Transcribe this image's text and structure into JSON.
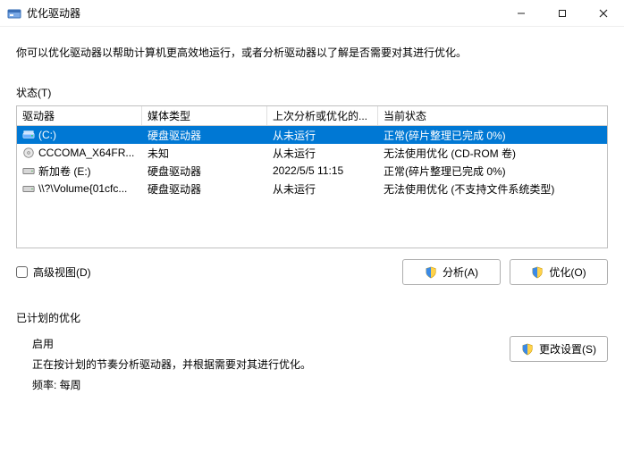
{
  "window": {
    "title": "优化驱动器"
  },
  "description": "你可以优化驱动器以帮助计算机更高效地运行，或者分析驱动器以了解是否需要对其进行优化。",
  "status_label": "状态(T)",
  "table": {
    "headers": {
      "drive": "驱动器",
      "media": "媒体类型",
      "last": "上次分析或优化的...",
      "state": "当前状态"
    },
    "rows": [
      {
        "drive": "(C:)",
        "media": "硬盘驱动器",
        "last": "从未运行",
        "state": "正常(碎片整理已完成 0%)",
        "icon": "os-drive",
        "selected": true
      },
      {
        "drive": "CCCOMA_X64FR...",
        "media": "未知",
        "last": "从未运行",
        "state": "无法使用优化 (CD-ROM 卷)",
        "icon": "cd-drive",
        "selected": false
      },
      {
        "drive": "新加卷 (E:)",
        "media": "硬盘驱动器",
        "last": "2022/5/5 11:15",
        "state": "正常(碎片整理已完成 0%)",
        "icon": "hdd-drive",
        "selected": false
      },
      {
        "drive": "\\\\?\\Volume{01cfc...",
        "media": "硬盘驱动器",
        "last": "从未运行",
        "state": "无法使用优化 (不支持文件系统类型)",
        "icon": "hdd-drive",
        "selected": false
      }
    ]
  },
  "advanced_view_label": "高级视图(D)",
  "buttons": {
    "analyze": "分析(A)",
    "optimize": "优化(O)",
    "change_settings": "更改设置(S)"
  },
  "scheduled": {
    "section": "已计划的优化",
    "on": "启用",
    "desc": "正在按计划的节奏分析驱动器，并根据需要对其进行优化。",
    "freq": "频率: 每周"
  }
}
